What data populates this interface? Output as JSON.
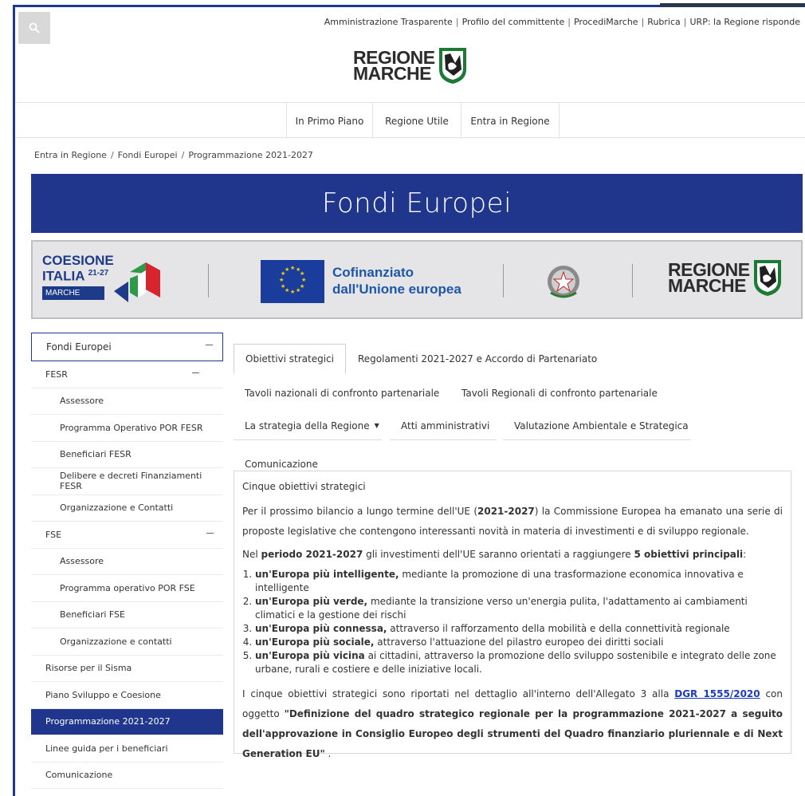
{
  "top_links": [
    "Amministrazione Trasparente",
    "Profilo del committente",
    "ProcediMarche",
    "Rubrica",
    "URP: la Regione risponde"
  ],
  "logo": {
    "line1": "REGIONE",
    "line2": "MARCHE"
  },
  "nav": [
    "In Primo Piano",
    "Regione Utile",
    "Entra in Regione"
  ],
  "breadcrumb": [
    "Entra in Regione",
    "Fondi Europei",
    "Programmazione 2021-2027"
  ],
  "hero_title": "Fondi Europei",
  "banner": {
    "coesione_line1": "COESIONE",
    "coesione_line2": "ITALIA",
    "coesione_years": "21-27",
    "coesione_region": "MARCHE",
    "cofin_line1": "Cofinanziato",
    "cofin_line2": "dall'Unione europea",
    "region_line1": "REGIONE",
    "region_line2": "MARCHE"
  },
  "sidebar": {
    "items": [
      {
        "label": "Fondi Europei"
      },
      {
        "label": "FESR"
      },
      {
        "label": "Assessore"
      },
      {
        "label": "Programma Operativo POR FESR"
      },
      {
        "label": "Beneficiari FESR"
      },
      {
        "label": "Delibere e decreti Finanziamenti FESR"
      },
      {
        "label": "Organizzazione e Contatti"
      },
      {
        "label": "FSE"
      },
      {
        "label": "Assessore"
      },
      {
        "label": "Programma operativo POR FSE"
      },
      {
        "label": "Beneficiari FSE"
      },
      {
        "label": "Organizzazione e contatti"
      },
      {
        "label": "Risorse per il Sisma"
      },
      {
        "label": "Piano Sviluppo e Coesione"
      },
      {
        "label": "Programmazione 2021-2027"
      },
      {
        "label": "Linee guida per i beneficiari"
      },
      {
        "label": "Comunicazione"
      }
    ]
  },
  "tabs": [
    "Obiettivi strategici",
    "Regolamenti 2021-2027 e Accordo di Partenariato",
    "Tavoli nazionali di confronto partenariale",
    "Tavoli Regionali di confronto partenariale",
    "La strategia della Regione",
    "Atti amministrativi",
    "Valutazione Ambientale e Strategica",
    "Comunicazione"
  ],
  "content": {
    "title": "Cinque obiettivi strategici",
    "p1_a": "Per il prossimo bilancio a lungo termine dell'UE (",
    "p1_b": "2021-2027",
    "p1_c": ") la Commissione Europea ha emanato una serie di proposte legislative che contengono interessanti novità in materia di investimenti e di sviluppo regionale.",
    "p2_a": "Nel ",
    "p2_b": "periodo 2021-2027",
    "p2_c": " gli investimenti dell'UE saranno orientati a raggiungere ",
    "p2_d": "5 obiettivi principali",
    "p2_e": ":",
    "list": [
      {
        "bold": "un'Europa più intelligente,",
        "rest": "  mediante la promozione di una trasformazione economica innovativa e intelligente"
      },
      {
        "bold": "un'Europa più verde,",
        "rest": "  mediante la transizione verso un'energia pulita, l'adattamento ai cambiamenti climatici e la gestione dei rischi"
      },
      {
        "bold": "un'Europa più connessa,",
        "rest": "  attraverso il rafforzamento della mobilità e della connettività regionale"
      },
      {
        "bold": "un'Europa più sociale,",
        "rest": "  attraverso l'attuazione del pilastro europeo dei diritti sociali"
      },
      {
        "bold": "un'Europa più vicina",
        "rest": "  ai cittadini, attraverso la promozione dello sviluppo sostenibile e integrato delle zone urbane, rurali e costiere e delle iniziative locali."
      }
    ],
    "p3_a": "I cinque obiettivi strategici sono riportati nel dettaglio all'interno dell'Allegato 3 alla ",
    "p3_link": "DGR 1555/2020",
    "p3_b": " con oggetto ",
    "p3_quote": "\"Definizione del quadro strategico regionale per la programmazione 2021-2027 a seguito dell'approvazione in Consiglio Europeo degli strumenti del Quadro finanziario pluriennale e di Next Generation EU\"",
    "p3_end": " ."
  },
  "colors": {
    "brand_blue": "#20368c",
    "link_blue": "#1a3cbd"
  }
}
